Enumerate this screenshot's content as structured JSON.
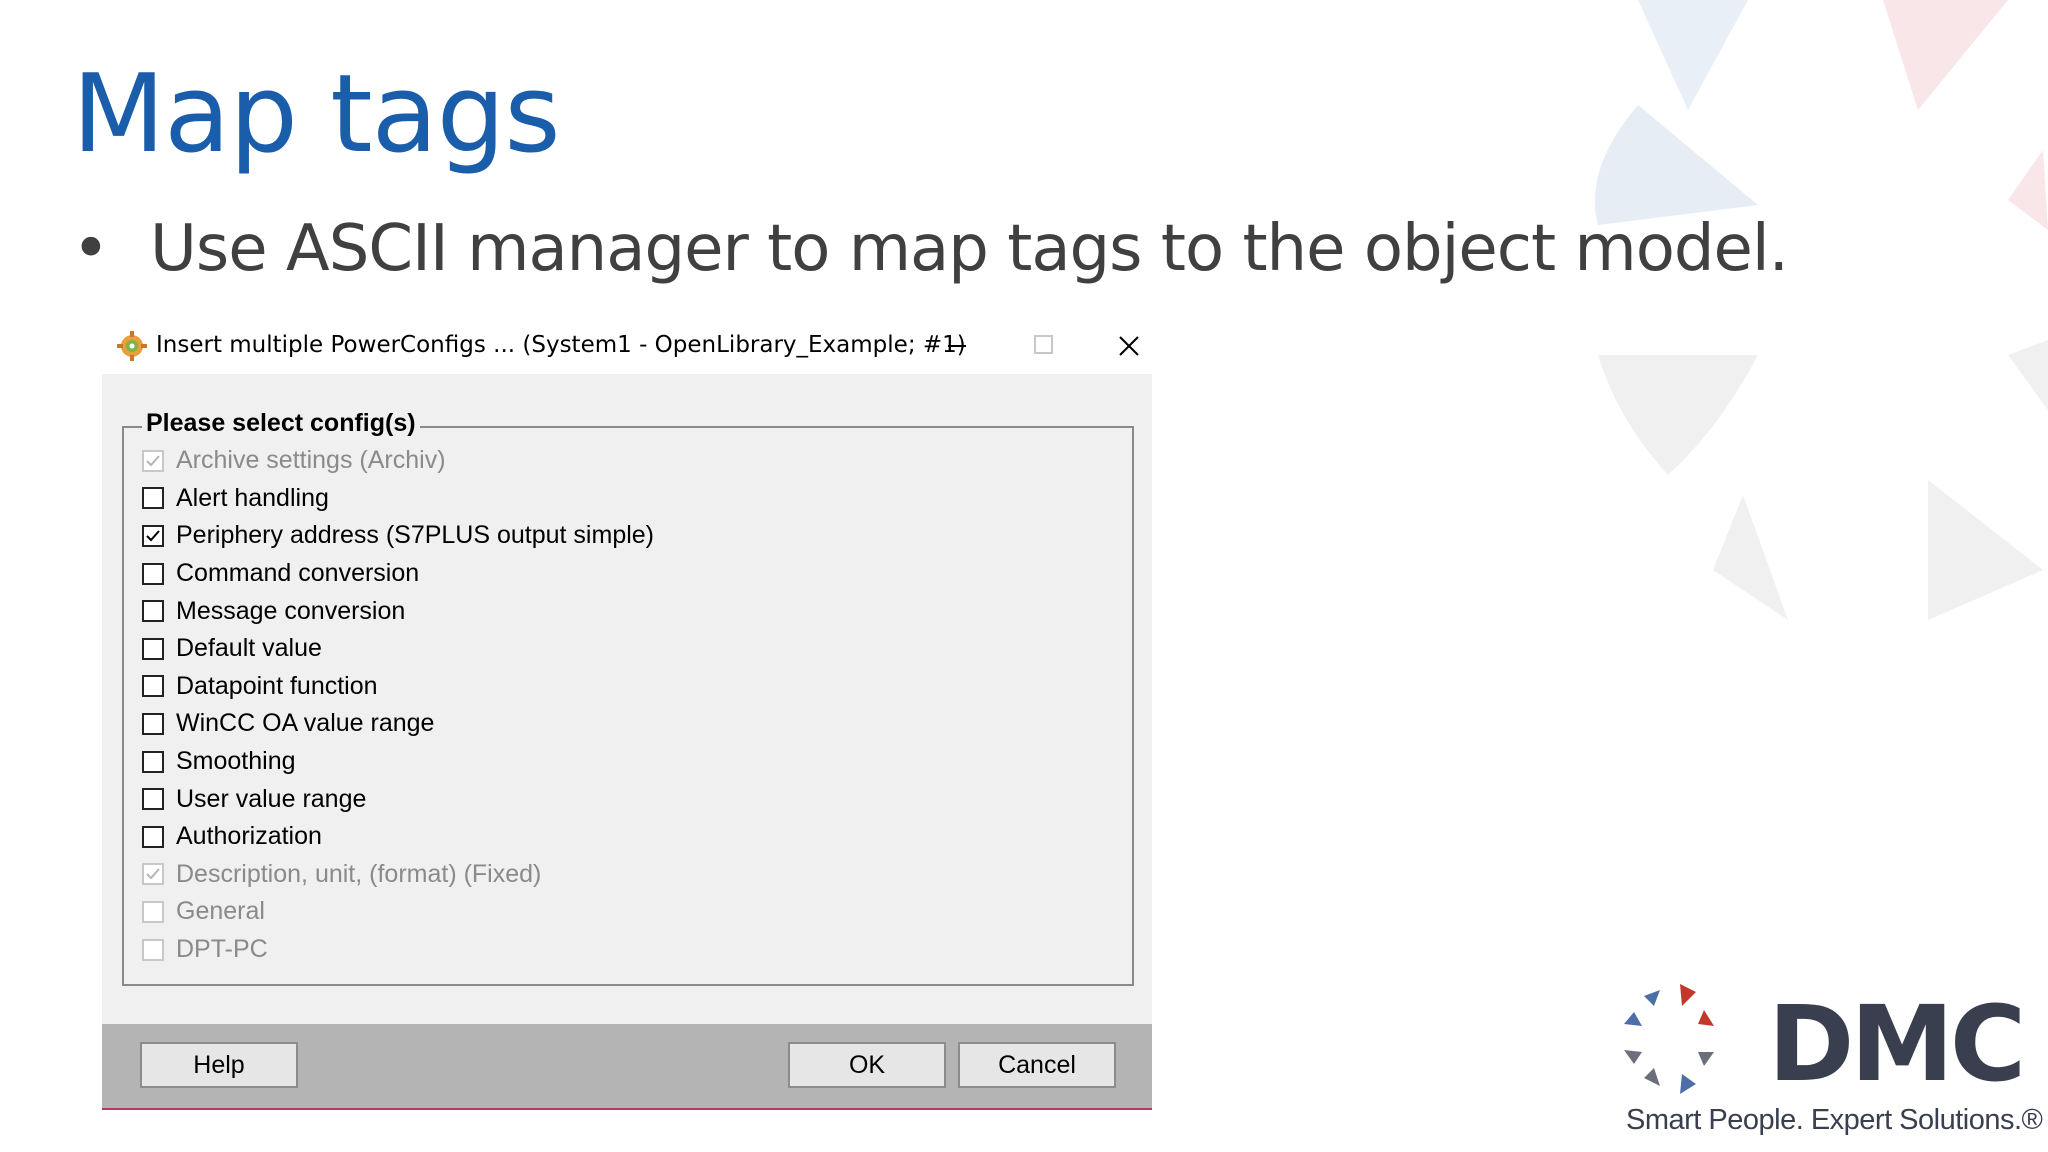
{
  "slide": {
    "title": "Map tags",
    "bullet_symbol": "•",
    "bullet_text": "Use ASCII manager to map tags to the object model."
  },
  "dialog": {
    "title": "Insert multiple PowerConfigs ... (System1 - OpenLibrary_Example; #1)",
    "group_label": "Please select config(s)",
    "options": [
      {
        "label": "Archive settings (Archiv)",
        "checked": true,
        "disabled": true
      },
      {
        "label": "Alert handling",
        "checked": false,
        "disabled": false
      },
      {
        "label": "Periphery address (S7PLUS output simple)",
        "checked": true,
        "disabled": false
      },
      {
        "label": "Command conversion",
        "checked": false,
        "disabled": false
      },
      {
        "label": "Message conversion",
        "checked": false,
        "disabled": false
      },
      {
        "label": "Default value",
        "checked": false,
        "disabled": false
      },
      {
        "label": "Datapoint function",
        "checked": false,
        "disabled": false
      },
      {
        "label": "WinCC OA value range",
        "checked": false,
        "disabled": false
      },
      {
        "label": "Smoothing",
        "checked": false,
        "disabled": false
      },
      {
        "label": "User value range",
        "checked": false,
        "disabled": false
      },
      {
        "label": "Authorization",
        "checked": false,
        "disabled": false
      },
      {
        "label": "Description, unit, (format) (Fixed)",
        "checked": true,
        "disabled": true
      },
      {
        "label": "General",
        "checked": false,
        "disabled": true
      },
      {
        "label": "DPT-PC",
        "checked": false,
        "disabled": true
      }
    ],
    "buttons": {
      "help": "Help",
      "ok": "OK",
      "cancel": "Cancel"
    }
  },
  "logo": {
    "name": "DMC",
    "tagline": "Smart People. Expert Solutions.®"
  },
  "colors": {
    "title_blue": "#1a5eab",
    "dialog_bg": "#f0f0f0",
    "footer_gray": "#b4b4b4",
    "accent_border": "#c0346a",
    "logo_text": "#3a3f4f"
  }
}
